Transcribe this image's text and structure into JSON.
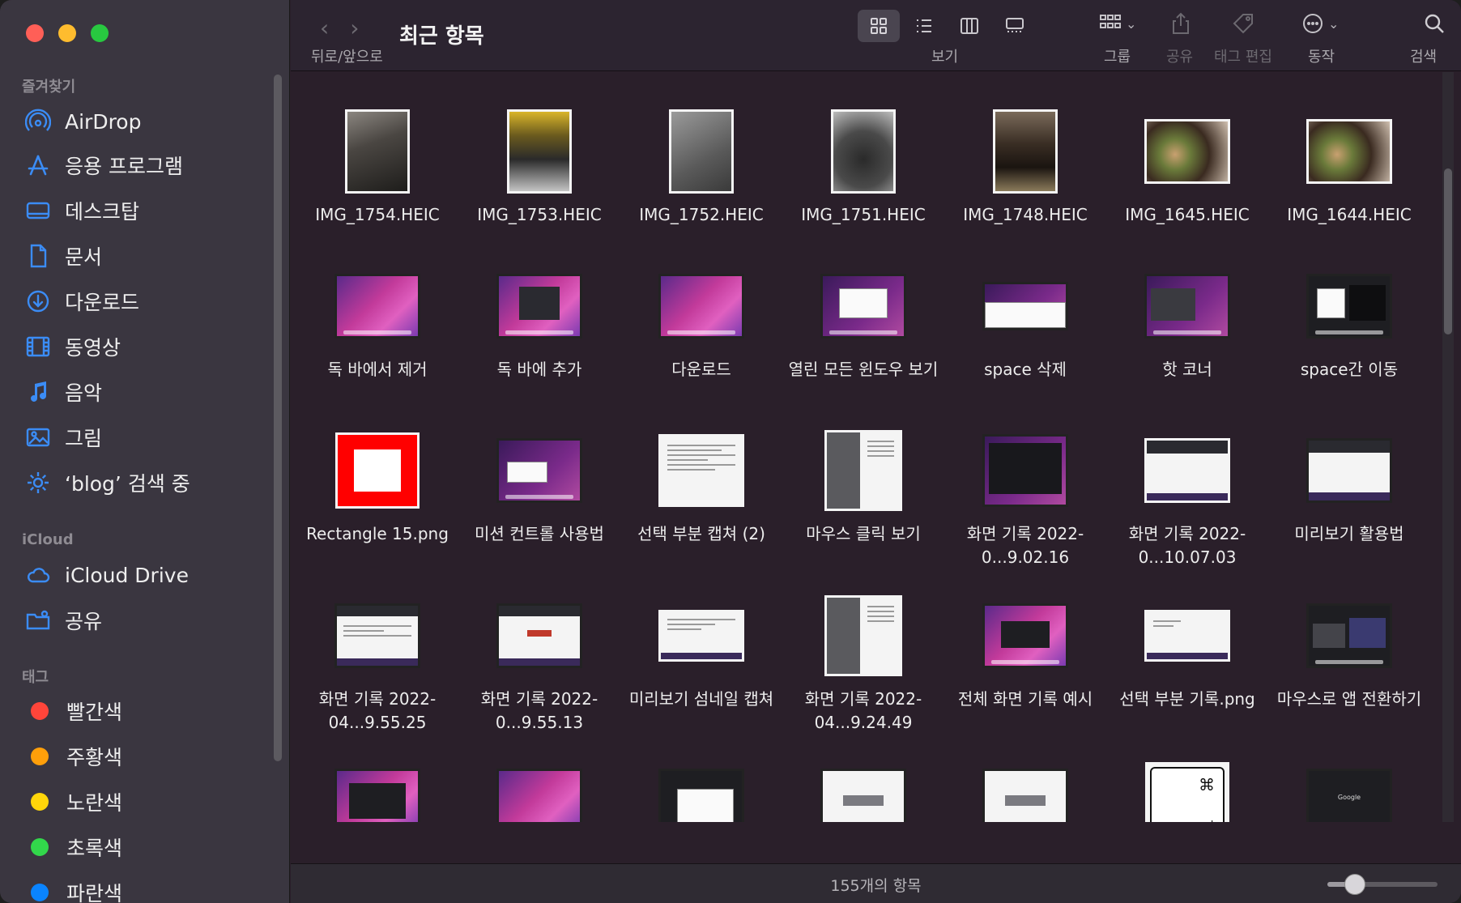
{
  "window": {
    "title": "최근 항목"
  },
  "toolbar": {
    "nav_label": "뒤로/앞으로",
    "view_label": "보기",
    "group_label": "그룹",
    "share_label": "공유",
    "tag_label": "태그 편집",
    "action_label": "동작",
    "search_label": "검색",
    "view_modes": [
      "icon-view",
      "list-view",
      "column-view",
      "gallery-view"
    ],
    "selected_view": "icon-view"
  },
  "sidebar": {
    "favorites_header": "즐겨찾기",
    "favorites": [
      {
        "label": "AirDrop",
        "icon": "airdrop-icon"
      },
      {
        "label": "응용 프로그램",
        "icon": "applications-icon"
      },
      {
        "label": "데스크탑",
        "icon": "desktop-icon"
      },
      {
        "label": "문서",
        "icon": "document-icon"
      },
      {
        "label": "다운로드",
        "icon": "download-icon"
      },
      {
        "label": "동영상",
        "icon": "movies-icon"
      },
      {
        "label": "음악",
        "icon": "music-icon"
      },
      {
        "label": "그림",
        "icon": "pictures-icon"
      },
      {
        "label": "‘blog’ 검색 중",
        "icon": "gear-icon"
      }
    ],
    "icloud_header": "iCloud",
    "icloud": [
      {
        "label": "iCloud Drive",
        "icon": "cloud-icon"
      },
      {
        "label": "공유",
        "icon": "shared-folder-icon"
      }
    ],
    "tags_header": "태그",
    "tags": [
      {
        "label": "빨간색",
        "color": "#ff453a"
      },
      {
        "label": "주황색",
        "color": "#ff9f0a"
      },
      {
        "label": "노란색",
        "color": "#ffd60a"
      },
      {
        "label": "초록색",
        "color": "#32d74b"
      },
      {
        "label": "파란색",
        "color": "#0a84ff"
      }
    ]
  },
  "files": [
    {
      "name": "IMG_1754.HEIC"
    },
    {
      "name": "IMG_1753.HEIC"
    },
    {
      "name": "IMG_1752.HEIC"
    },
    {
      "name": "IMG_1751.HEIC"
    },
    {
      "name": "IMG_1748.HEIC"
    },
    {
      "name": "IMG_1645.HEIC"
    },
    {
      "name": "IMG_1644.HEIC"
    },
    {
      "name": "독 바에서 제거"
    },
    {
      "name": "독 바에 추가"
    },
    {
      "name": "다운로드"
    },
    {
      "name": "열린 모든 윈도우 보기"
    },
    {
      "name": "space 삭제"
    },
    {
      "name": "핫 코너"
    },
    {
      "name": "space간 이동"
    },
    {
      "name": "Rectangle 15.png"
    },
    {
      "name": "미션 컨트롤 사용법"
    },
    {
      "name": "선택 부분 캡쳐 (2)"
    },
    {
      "name": "마우스 클릭 보기"
    },
    {
      "name": "화면 기록 2022-0...9.02.16"
    },
    {
      "name": "화면 기록 2022-0...10.07.03"
    },
    {
      "name": "미리보기 활용법"
    },
    {
      "name": "화면 기록 2022-04...9.55.25"
    },
    {
      "name": "화면 기록 2022-0...9.55.13"
    },
    {
      "name": "미리보기 섬네일 캡쳐"
    },
    {
      "name": "화면 기록 2022-04...9.24.49"
    },
    {
      "name": "전체 화면 기록 예시"
    },
    {
      "name": "선택 부분 기록.png"
    },
    {
      "name": "마우스로 앱 전환하기"
    }
  ],
  "partial_thumbs": {
    "command_label": "command",
    "command_symbol": "⌘",
    "google_label": "Google"
  },
  "status": {
    "item_count": "155개의 항목",
    "zoom_level": 0.25
  }
}
